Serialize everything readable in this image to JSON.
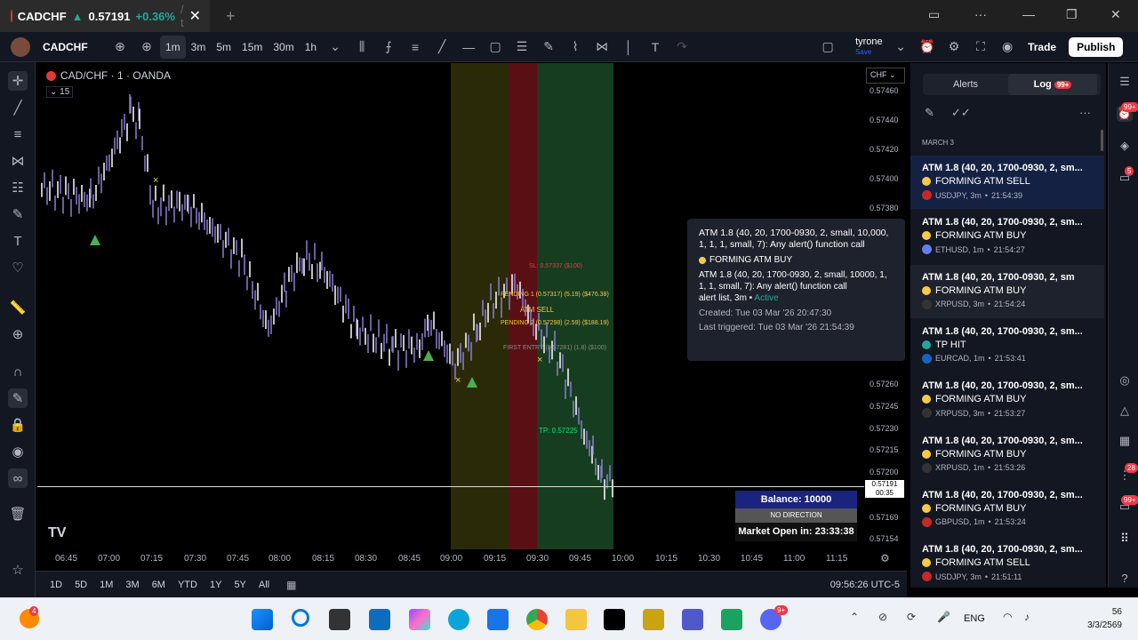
{
  "browser": {
    "tab_symbol": "CADCHF",
    "tab_arrow": "▲",
    "tab_price": "0.57191",
    "tab_change": "+0.36%",
    "tab_suffix": "/ t"
  },
  "toolbar": {
    "symbol": "CADCHF",
    "intervals": [
      "1m",
      "3m",
      "5m",
      "15m",
      "30m",
      "1h"
    ],
    "active_interval": "1m",
    "layout_name": "tyrone",
    "layout_status": "Save",
    "trade_label": "Trade",
    "publish_label": "Publish"
  },
  "chart": {
    "title": "CAD/CHF · 1 · OANDA",
    "indicator_count": "15",
    "currency": "CHF",
    "current_price": "0.57191",
    "countdown": "00:35",
    "price_ticks": [
      "0.57460",
      "0.57440",
      "0.57420",
      "0.57400",
      "0.57380",
      "0.57260",
      "0.57245",
      "0.57230",
      "0.57215",
      "0.57200",
      "0.57169",
      "0.57154"
    ],
    "time_ticks": [
      "06:45",
      "07:00",
      "07:15",
      "07:30",
      "07:45",
      "08:00",
      "08:15",
      "08:30",
      "08:45",
      "09:00",
      "09:15",
      "09:30",
      "09:45",
      "10:00",
      "10:15",
      "10:30",
      "10:45",
      "11:00",
      "11:15"
    ],
    "annotations": {
      "sl": "SL: 0.57337 ($100)",
      "pending1": "PENDING 1 (0.57317) (5.19) ($476.38)",
      "atm_sell": "ATM SELL",
      "pending2": "PENDING 2 (0.57298) (2.59) ($188.19)",
      "first_entry": "FIRST ENTRY (0.57281) (1.8) ($100)",
      "tp": "TP: 0.57225"
    },
    "balance": "Balance: 10000",
    "direction": "NO DIRECTION",
    "market_open": "Market Open in: 23:33:38"
  },
  "popup": {
    "title": "ATM 1.8 (40, 20, 1700-0930, 2, small, 10,000, 1, 1, 1, small, 7): Any alert() function call",
    "quote": "FORMING ATM BUY",
    "body": "ATM 1.8 (40, 20, 1700-0930, 2, small, 10000, 1, 1, 1, small, 7): Any alert() function call",
    "list": "alert list, 3m",
    "status": "Active",
    "created": "Created: Tue 03 Mar '26   20:47:30",
    "triggered": "Last triggered: Tue 03 Mar '26   21:54:39"
  },
  "panel": {
    "tab_alerts": "Alerts",
    "tab_log": "Log",
    "log_badge": "99+",
    "date": "MARCH 3",
    "items": [
      {
        "title": "ATM 1.8 (40, 20, 1700-0930, 2, sm...",
        "msg": "FORMING ATM SELL",
        "symbol": "USDJPY, 3m",
        "time": "21:54:39",
        "dot": "#f7c948"
      },
      {
        "title": "ATM 1.8 (40, 20, 1700-0930, 2, sm...",
        "msg": "FORMING ATM BUY",
        "symbol": "ETHUSD, 1m",
        "time": "21:54:27",
        "dot": "#f7c948"
      },
      {
        "title": "ATM 1.8 (40, 20, 1700-0930, 2, sm",
        "msg": "FORMING ATM BUY",
        "symbol": "XRPUSD, 3m",
        "time": "21:54:24",
        "dot": "#f7c948"
      },
      {
        "title": "ATM 1.8 (40, 20, 1700-0930, 2, sm...",
        "msg": "TP HIT",
        "symbol": "EURCAD, 1m",
        "time": "21:53:41",
        "dot": "#26a69a"
      },
      {
        "title": "ATM 1.8 (40, 20, 1700-0930, 2, sm...",
        "msg": "FORMING ATM BUY",
        "symbol": "XRPUSD, 3m",
        "time": "21:53:27",
        "dot": "#f7c948"
      },
      {
        "title": "ATM 1.8 (40, 20, 1700-0930, 2, sm...",
        "msg": "FORMING ATM BUY",
        "symbol": "XRPUSD, 1m",
        "time": "21:53:26",
        "dot": "#f7c948"
      },
      {
        "title": "ATM 1.8 (40, 20, 1700-0930, 2, sm...",
        "msg": "FORMING ATM BUY",
        "symbol": "GBPUSD, 1m",
        "time": "21:53:24",
        "dot": "#f7c948"
      },
      {
        "title": "ATM 1.8 (40, 20, 1700-0930, 2, sm...",
        "msg": "FORMING ATM SELL",
        "symbol": "USDJPY, 3m",
        "time": "21:51:11",
        "dot": "#f7c948"
      }
    ]
  },
  "bottom": {
    "ranges": [
      "1D",
      "5D",
      "1M",
      "3M",
      "6M",
      "YTD",
      "1Y",
      "5Y",
      "All"
    ],
    "clock": "09:56:26 UTC-5"
  },
  "taskbar": {
    "lang": "ENG",
    "time": "56",
    "date": "3/3/2569",
    "edge_badge": "4"
  }
}
